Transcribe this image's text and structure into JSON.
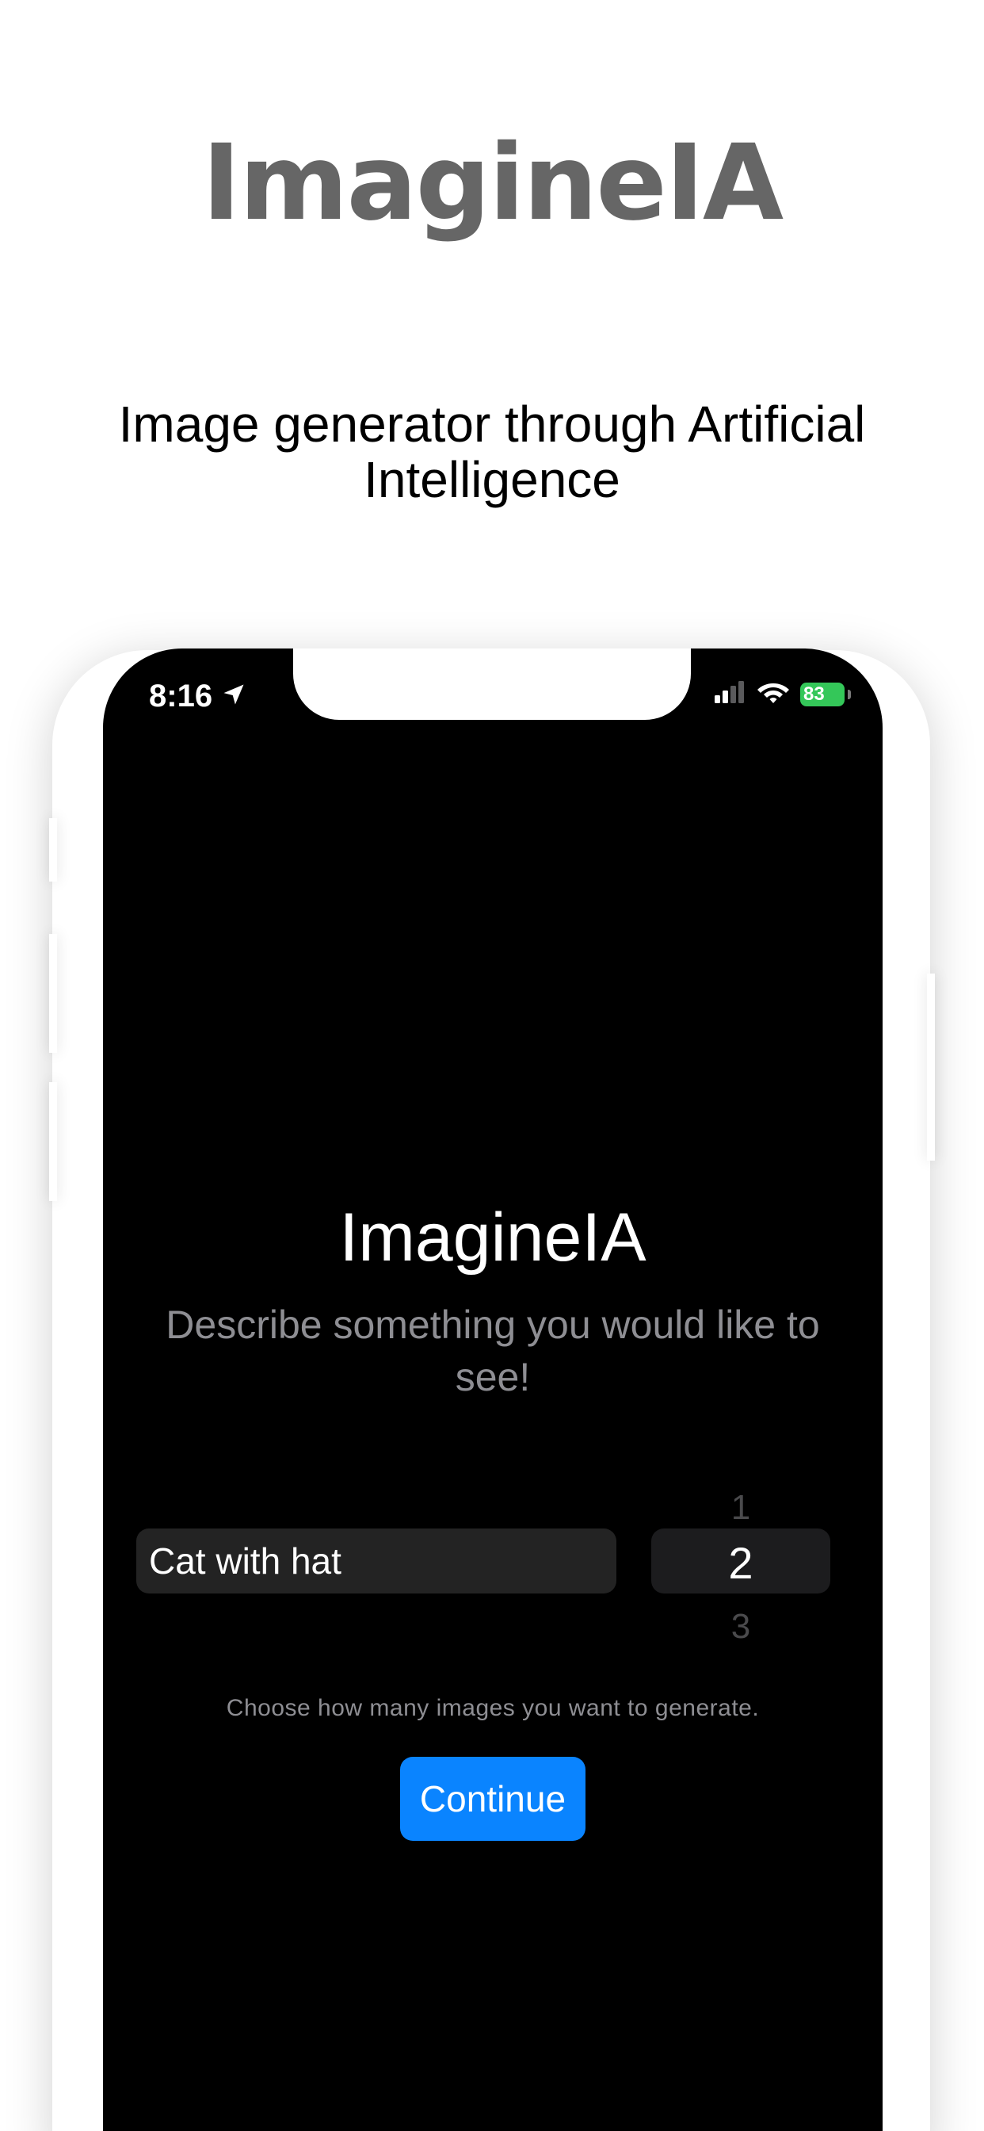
{
  "hero": {
    "title": "ImagineIA",
    "subtitle": "Image generator through Artificial Intelligence"
  },
  "status_bar": {
    "time": "8:16",
    "battery": "83",
    "icons": [
      "location-arrow-icon",
      "cellular-signal-icon",
      "wifi-icon",
      "battery-charging-icon"
    ],
    "battery_color": "#34c759"
  },
  "app": {
    "title": "ImagineIA",
    "description": "Describe something you would like to see!",
    "prompt_value": "Cat with hat",
    "picker": {
      "prev": "1",
      "selected": "2",
      "next": "3"
    },
    "hint": "Choose how many images you want to generate.",
    "continue_label": "Continue",
    "accent_color": "#0a84ff"
  }
}
